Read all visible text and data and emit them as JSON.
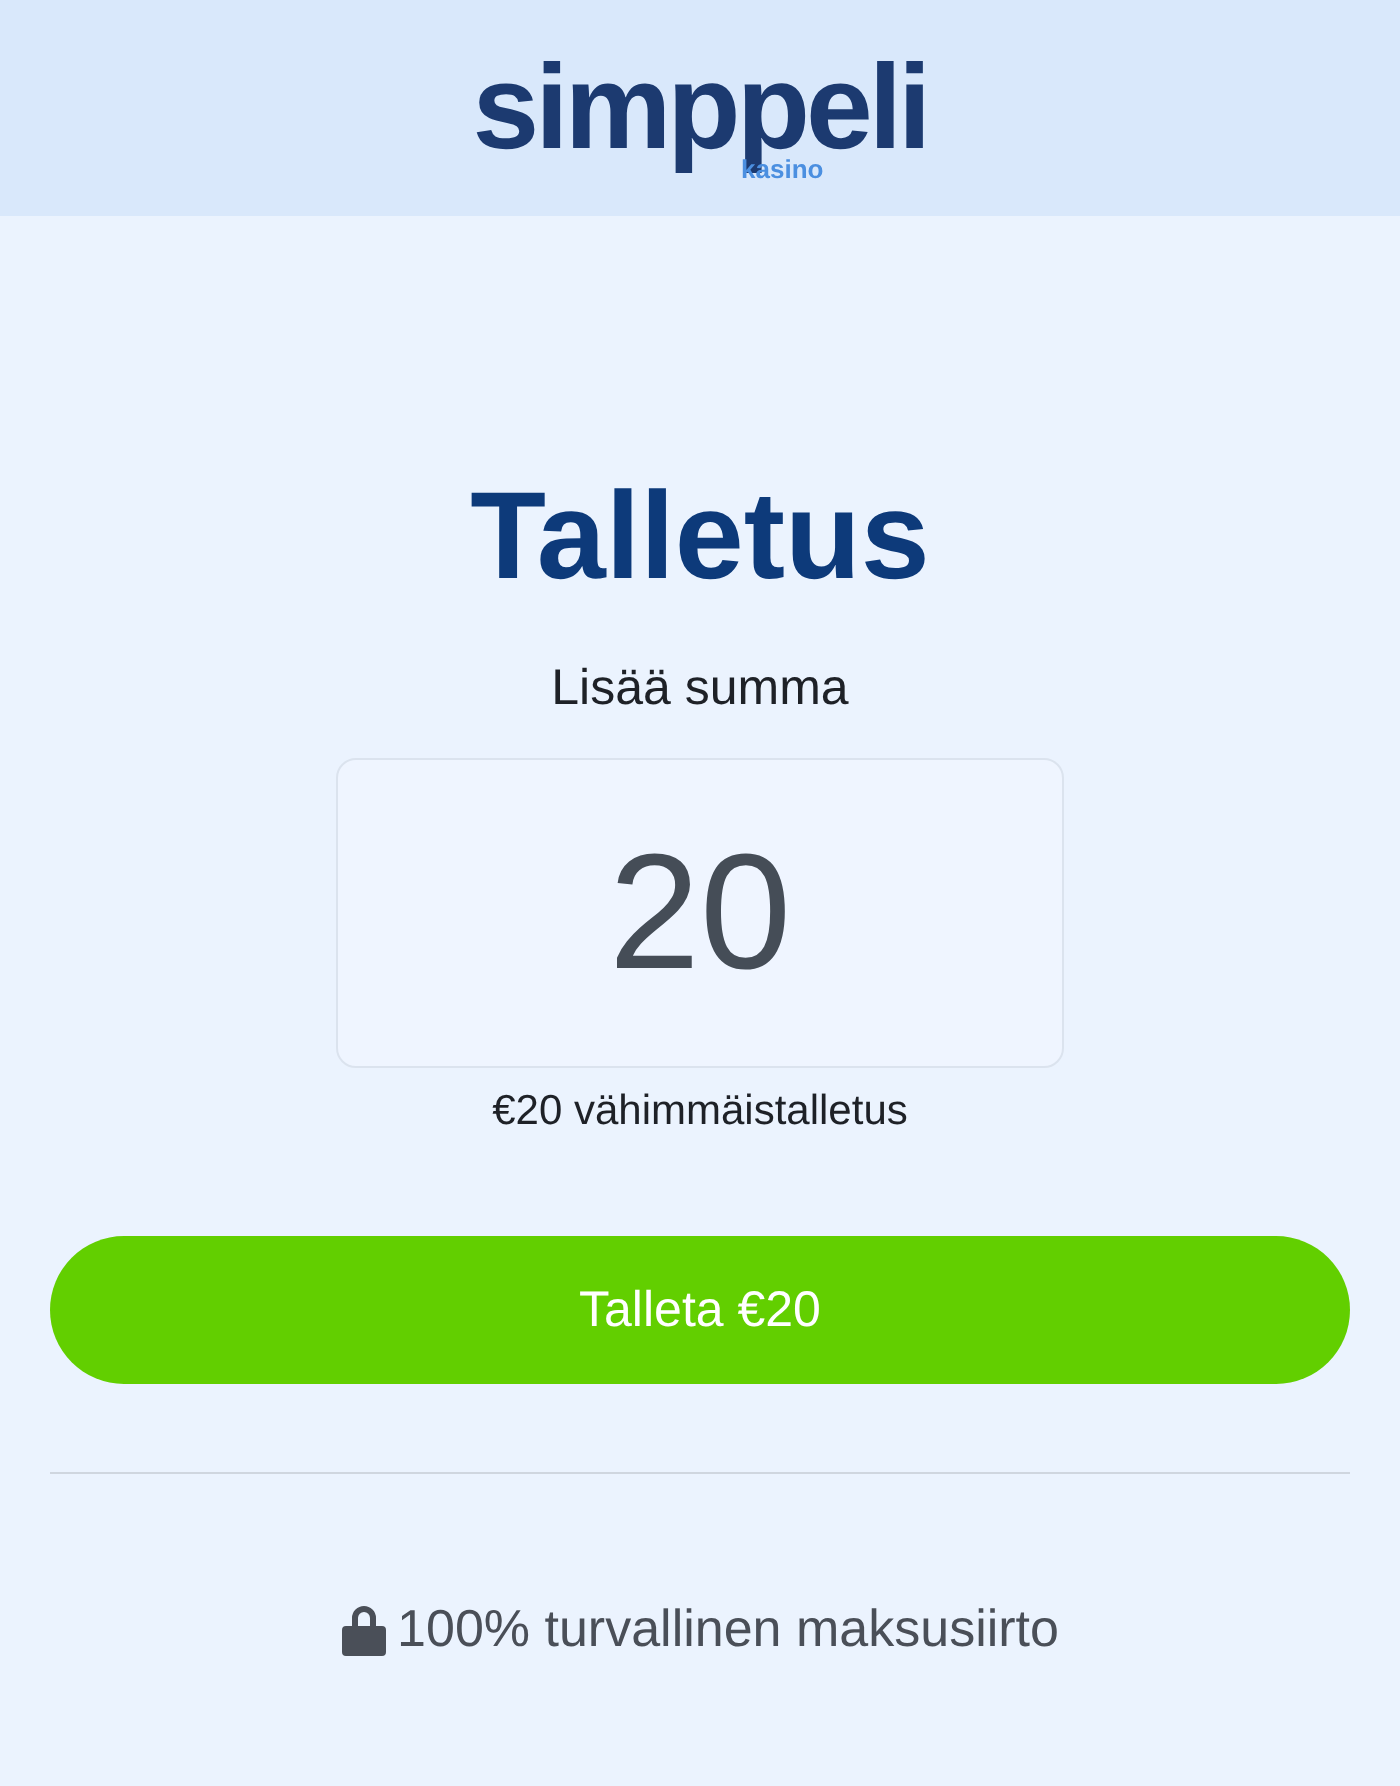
{
  "header": {
    "logo": "simppeli",
    "logo_subtitle": "kasino"
  },
  "title": "Talletus",
  "amount_label": "Lisää summa",
  "amount_field": {
    "value": "20"
  },
  "minimum_note": "€20 vähimmäistalletus",
  "deposit_button": "Talleta €20",
  "security_note": "100% turvallinen maksusiirto"
}
